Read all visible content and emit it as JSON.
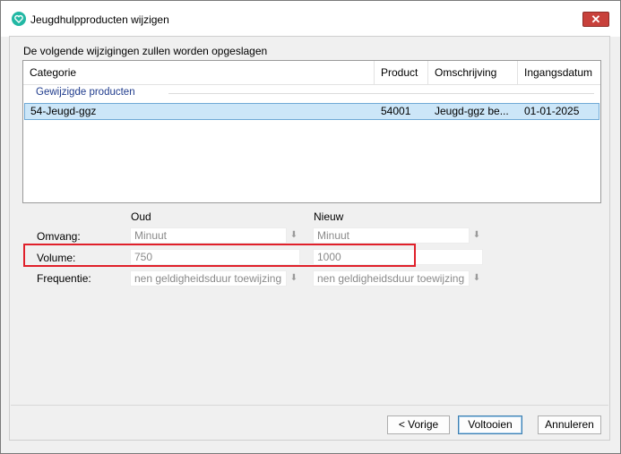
{
  "window": {
    "title": "Jeugdhulpproducten wijzigen"
  },
  "intro": "De volgende wijzigingen zullen worden opgeslagen",
  "table": {
    "columns": [
      "Categorie",
      "Product",
      "Omschrijving",
      "Ingangsdatum"
    ],
    "group_label": "Gewijzigde producten",
    "rows": [
      {
        "categorie": "54-Jeugd-ggz",
        "product": "54001",
        "omschrijving": "Jeugd-ggz be...",
        "ingangsdatum": "01-01-2025"
      }
    ]
  },
  "compare": {
    "old_label": "Oud",
    "new_label": "Nieuw",
    "fields": [
      {
        "label": "Omvang:",
        "old": "Minuut",
        "new": "Minuut"
      },
      {
        "label": "Volume:",
        "old": "750",
        "new": "1000"
      },
      {
        "label": "Frequentie:",
        "old": "nen geldigheidsduur toewijzing",
        "new": "nen geldigheidsduur toewijzing"
      }
    ]
  },
  "buttons": {
    "back": "< Vorige",
    "finish": "Voltooien",
    "cancel": "Annuleren"
  },
  "icons": {
    "app": "heart-icon",
    "close": "close-icon",
    "dropdown": "dropdown-arrow-icon"
  },
  "colors": {
    "accent": "#1f3b8c",
    "selection": "#cce6f8",
    "highlight": "#e0202a",
    "close": "#c8413b"
  }
}
